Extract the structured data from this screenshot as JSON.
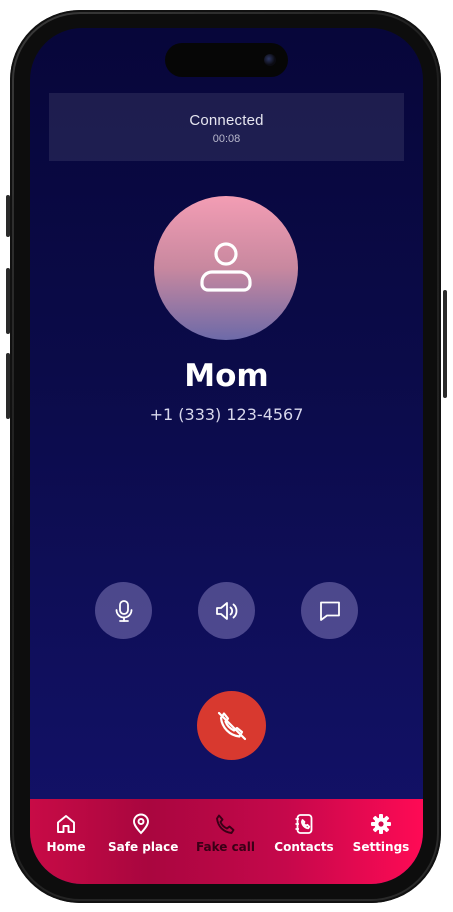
{
  "call": {
    "status": "Connected",
    "duration": "00:08",
    "caller_name": "Mom",
    "caller_number": "+1 (333) 123-4567"
  },
  "controls": [
    {
      "icon": "microphone-icon"
    },
    {
      "icon": "speaker-icon"
    },
    {
      "icon": "message-icon"
    }
  ],
  "end_call": {
    "icon": "phone-hangup-icon",
    "color": "#d8392f"
  },
  "tabbar": {
    "items": [
      {
        "label": "Home",
        "icon": "home-icon"
      },
      {
        "label": "Safe place",
        "icon": "location-pin-icon"
      },
      {
        "label": "Fake call",
        "icon": "phone-icon",
        "active": true
      },
      {
        "label": "Contacts",
        "icon": "contacts-book-icon"
      },
      {
        "label": "Settings",
        "icon": "gear-icon"
      }
    ]
  },
  "colors": {
    "screen_top": "#07063a",
    "screen_bottom": "#13126b",
    "tabbar_accent": "#ff0a55",
    "end_call": "#d8392f"
  }
}
